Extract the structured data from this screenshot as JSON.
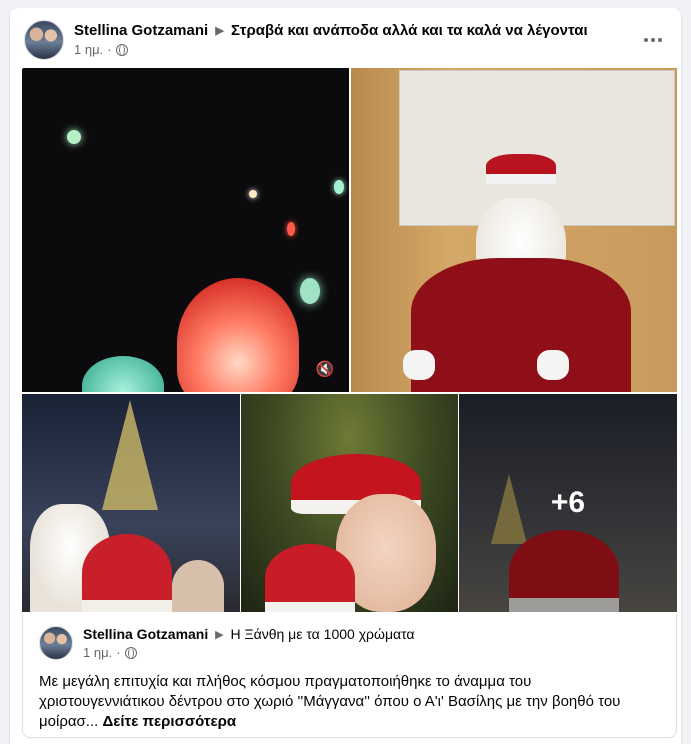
{
  "post": {
    "author": "Stellina Gotzamani",
    "separator": "▶",
    "group": "Στραβά και ανάποδα αλλά και τα καλά να λέγονται",
    "time": "1 ημ.",
    "privacy_icon": "globe-icon",
    "more_icon": "ellipsis-icon"
  },
  "gallery": {
    "extra_count": "+6",
    "mute_icon": "🔇"
  },
  "shared": {
    "author": "Stellina Gotzamani",
    "separator": "▶",
    "group": "Η Ξάνθη με τα 1000 χρώματα",
    "time": "1 ημ.",
    "text": "Με μεγάλη επιτυχία και πλήθος κόσμου πραγματοποιήθηκε το άναμμα του χριστουγεννιάτικου δέντρου στο χωριό ''Μάγγανα''  όπου ο Α'ι' Βασίλης με την βοηθό του μοίρασ...",
    "see_more": "Δείτε περισσότερα"
  },
  "colors": {
    "text": "#050505",
    "muted": "#65676b",
    "bg": "#f0f2f5"
  }
}
